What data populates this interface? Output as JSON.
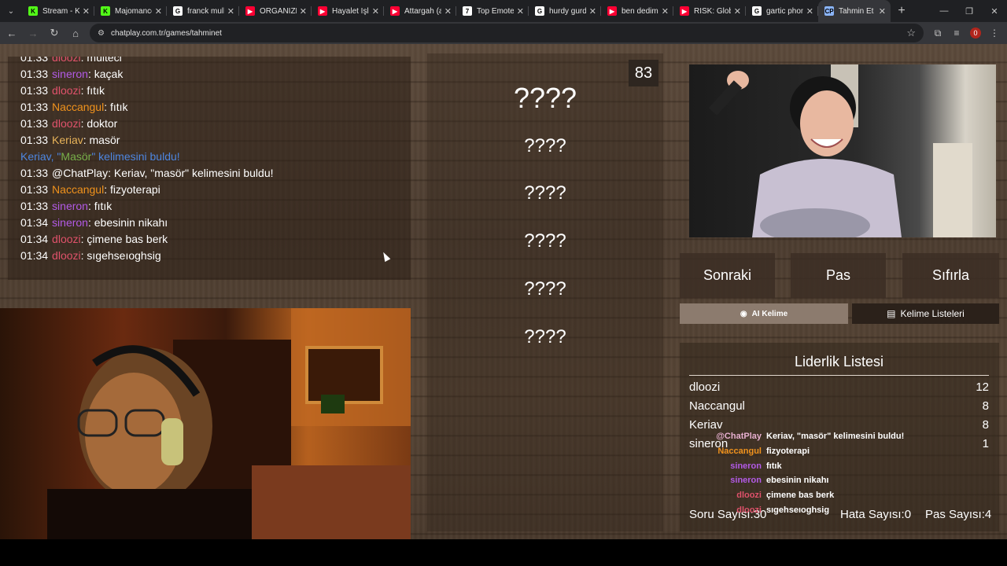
{
  "browser": {
    "tabs": [
      {
        "title": "Stream - Kick",
        "icon": "kick-icon",
        "color": "#53fc18",
        "glyph": "K"
      },
      {
        "title": "Majomancer",
        "icon": "kick-icon",
        "color": "#53fc18",
        "glyph": "K"
      },
      {
        "title": "franck muller",
        "icon": "google-icon",
        "color": "#ffffff",
        "glyph": "G"
      },
      {
        "title": "ORGANIZE",
        "icon": "youtube-icon",
        "color": "#ff0033",
        "glyph": "▶"
      },
      {
        "title": "Hayalet Işlığı",
        "icon": "youtube-icon",
        "color": "#ff0033",
        "glyph": "▶"
      },
      {
        "title": "Attargah (arşiv)",
        "icon": "youtube-icon",
        "color": "#ff0033",
        "glyph": "▶"
      },
      {
        "title": "Top Emotes",
        "icon": "seventv-icon",
        "color": "#ffffff",
        "glyph": "7"
      },
      {
        "title": "hurdy gurdy",
        "icon": "google-icon",
        "color": "#ffffff",
        "glyph": "G"
      },
      {
        "title": "ben dedim h",
        "icon": "youtube-icon",
        "color": "#ff0033",
        "glyph": "▶"
      },
      {
        "title": "RISK: Global",
        "icon": "youtube-icon",
        "color": "#ff0033",
        "glyph": "▶"
      },
      {
        "title": "gartic phone",
        "icon": "google-icon",
        "color": "#ffffff",
        "glyph": "G"
      },
      {
        "title": "Tahmin Et - ChatPlay",
        "icon": "chatplay-icon",
        "color": "#8ab4f8",
        "glyph": "CP",
        "active": true
      }
    ],
    "url": "chatplay.com.tr/games/tahminet",
    "extension_badge": "0"
  },
  "chat": [
    {
      "time": "01:33",
      "user": "dloozi",
      "color": "#e0526b",
      "msg": "mülteci"
    },
    {
      "time": "01:33",
      "user": "sineron",
      "color": "#b25ae6",
      "msg": "kaçak"
    },
    {
      "time": "01:33",
      "user": "dloozi",
      "color": "#e0526b",
      "msg": "fıtık"
    },
    {
      "time": "01:33",
      "user": "Naccangul",
      "color": "#f0921c",
      "msg": "fıtık"
    },
    {
      "time": "01:33",
      "user": "dloozi",
      "color": "#e0526b",
      "msg": "doktor"
    },
    {
      "time": "01:33",
      "user": "Keriav",
      "color": "#e9b45a",
      "msg": "masör"
    },
    {
      "system": true,
      "pre": "Keriav, \"",
      "accent": "Masör",
      "post": "\" kelimesini buldu!"
    },
    {
      "time": "01:33",
      "user": "@ChatPlay",
      "color": "#ffffff",
      "msg": "Keriav, \"masör\" kelimesini buldu!"
    },
    {
      "time": "01:33",
      "user": "Naccangul",
      "color": "#f0921c",
      "msg": "fizyoterapi"
    },
    {
      "time": "01:33",
      "user": "sineron",
      "color": "#b25ae6",
      "msg": "fıtık"
    },
    {
      "time": "01:34",
      "user": "sineron",
      "color": "#b25ae6",
      "msg": "ebesinin nikahı"
    },
    {
      "time": "01:34",
      "user": "dloozi",
      "color": "#e0526b",
      "msg": "çimene bas berk"
    },
    {
      "time": "01:34",
      "user": "dloozi",
      "color": "#e0526b",
      "msg": "sıgehseıoghsig"
    }
  ],
  "game": {
    "timer": "83",
    "main_word": "????",
    "words": [
      "????",
      "????",
      "????",
      "????",
      "????"
    ]
  },
  "controls": {
    "next": "Sonraki",
    "pass": "Pas",
    "reset": "Sıfırla",
    "ai_word": "AI Kelime",
    "word_lists": "Kelime Listeleri"
  },
  "leaderboard": {
    "title": "Liderlik Listesi",
    "rows": [
      {
        "name": "dloozi",
        "score": "12"
      },
      {
        "name": "Naccangul",
        "score": "8"
      },
      {
        "name": "Keriav",
        "score": "8"
      },
      {
        "name": "sineron",
        "score": "1"
      }
    ],
    "questions_label": "Soru Sayısı:",
    "questions_value": "30",
    "errors_label": "Hata Sayısı:",
    "errors_value": "0",
    "passes_label": "Pas Sayısı:",
    "passes_value": "4"
  },
  "overlay": [
    {
      "user": "@ChatPlay",
      "color": "#e8b0d0",
      "msg": "Keriav, \"masör\" kelimesini buldu!"
    },
    {
      "user": "Naccangul",
      "color": "#f0921c",
      "msg": "fizyoterapi"
    },
    {
      "user": "sineron",
      "color": "#b25ae6",
      "msg": "fıtık"
    },
    {
      "user": "sineron",
      "color": "#b25ae6",
      "msg": "ebesinin nikahı"
    },
    {
      "user": "dloozi",
      "color": "#e0526b",
      "msg": "çimene bas berk"
    },
    {
      "user": "dloozi",
      "color": "#e0526b",
      "msg": "sıgehseıoghsig"
    }
  ]
}
